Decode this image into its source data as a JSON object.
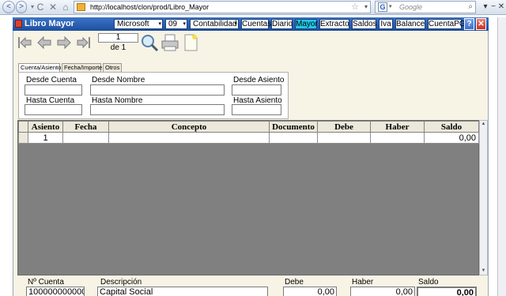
{
  "browser": {
    "url": "http://localhost/clon/prod/Libro_Mayor",
    "search_placeholder": "Google",
    "search_engine_letter": "G",
    "back_label": "<",
    "forward_label": ">",
    "dropdown_label": "▾",
    "reload_label": "C",
    "stop_label": "✕",
    "home_label": "⌂",
    "star_label": "☆",
    "magnify_label": "⌕",
    "minimize_label": "−",
    "menu_label": "▾"
  },
  "app": {
    "title": "Libro Mayor",
    "company_select": "Microsoft",
    "period_select": "09",
    "ledger_select": "Contabilidad",
    "menu": [
      "Cuentas",
      "Diario",
      "Mayor",
      "Extracto",
      "Saldos",
      "Iva",
      "Balance",
      "CuentaPG"
    ],
    "active_menu": "Mayor",
    "help_label": "?",
    "close_label": "✕",
    "select_arrow": "▾"
  },
  "toolbar": {
    "current_page": "1",
    "page_total": "de 1"
  },
  "filters": {
    "tabs": [
      "Cuenta/Asiento",
      "Fecha/Importe",
      "Otros"
    ],
    "active_tab": "Cuenta/Asiento",
    "desde_cuenta": "Desde Cuenta",
    "desde_nombre": "Desde Nombre",
    "desde_asiento": "Desde Asiento",
    "hasta_cuenta": "Hasta Cuenta",
    "hasta_nombre": "Hasta Nombre",
    "hasta_asiento": "Hasta Asiento"
  },
  "grid": {
    "columns": [
      "Asiento",
      "Fecha",
      "Concepto",
      "Documento",
      "Debe",
      "Haber",
      "Saldo"
    ],
    "rows": [
      {
        "asiento": "1",
        "fecha": "",
        "concepto": "",
        "documento": "",
        "debe": "",
        "haber": "",
        "saldo": "0,00"
      }
    ],
    "scroll_up": "▲",
    "scroll_down": "▼"
  },
  "footer": {
    "cuenta_label": "Nº Cuenta",
    "cuenta_value": "100000000000",
    "descripcion_label": "Descripción",
    "descripcion_value": "Capital Social",
    "debe_label": "Debe",
    "debe_value": "0,00",
    "haber_label": "Haber",
    "haber_value": "0,00",
    "saldo_label": "Saldo",
    "saldo_value": "0,00"
  },
  "colors": {
    "title_bar": "#1e4f9e",
    "active_menu": "#22c8e8",
    "panel_bg": "#f7f3e5",
    "grid_bg": "#808080"
  }
}
